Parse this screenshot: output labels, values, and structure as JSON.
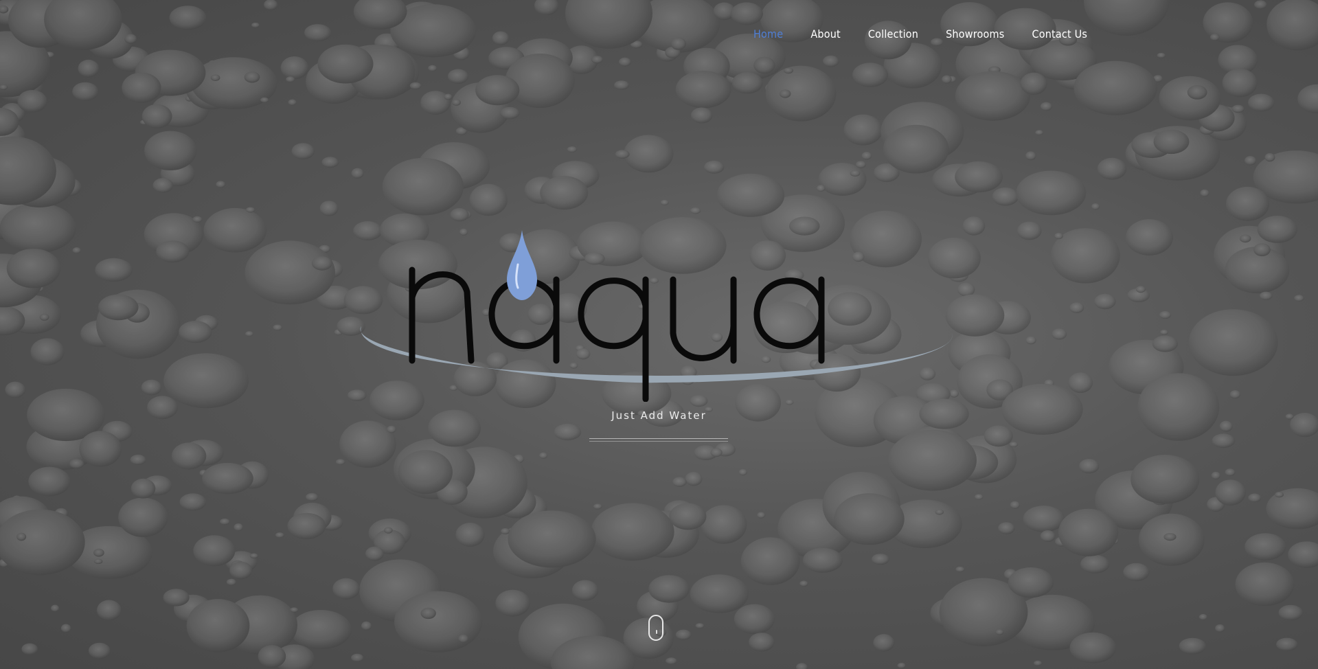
{
  "nav": {
    "items": [
      {
        "label": "Home",
        "active": true
      },
      {
        "label": "About",
        "active": false
      },
      {
        "label": "Collection",
        "active": false
      },
      {
        "label": "Showrooms",
        "active": false
      },
      {
        "label": "Contact Us",
        "active": false
      }
    ]
  },
  "brand": {
    "logo_text": "n'aqua",
    "tagline": "Just Add Water"
  },
  "colors": {
    "accent": "#4f7fd6",
    "background": "#555555",
    "drop": "#7f9fd8",
    "swoosh": "#9aa7b3"
  },
  "icons": {
    "scroll": "mouse-scroll-icon"
  }
}
